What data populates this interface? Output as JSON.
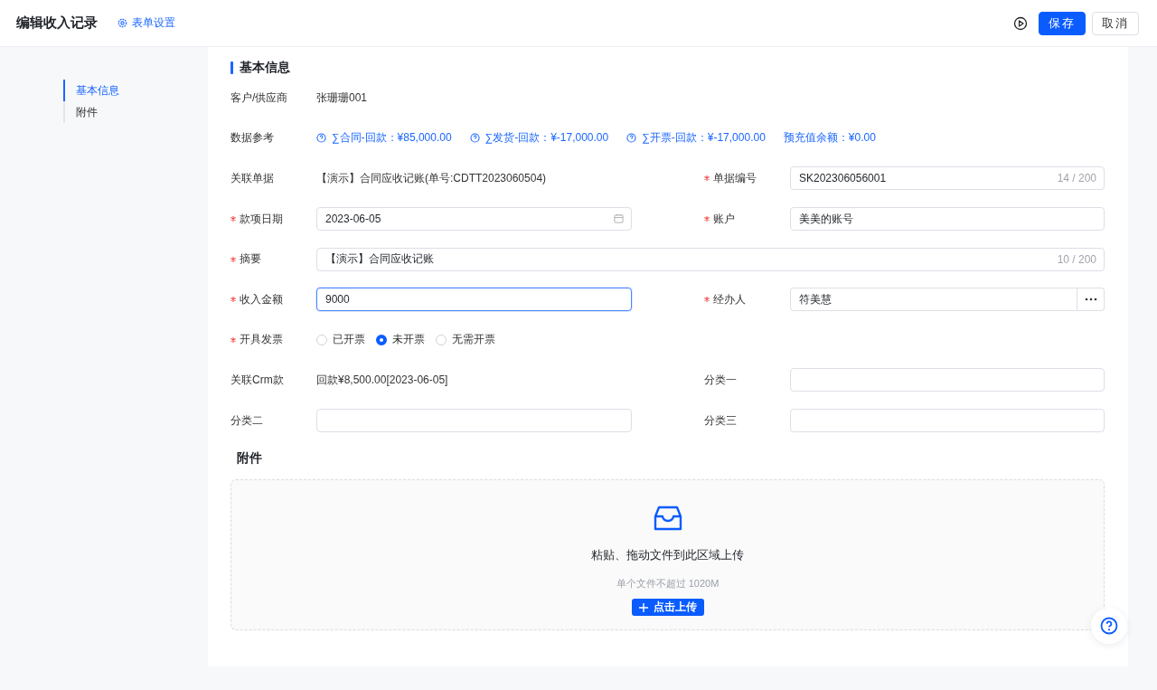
{
  "header": {
    "title": "编辑收入记录",
    "settings_link": "表单设置",
    "save_button": "保存",
    "cancel_button": "取消"
  },
  "nav": [
    {
      "label": "基本信息",
      "selected": true
    },
    {
      "label": "附件",
      "selected": false
    }
  ],
  "basic_info": {
    "title": "基本信息",
    "rows": [
      [
        {
          "label": "客户/供应商",
          "kind": "text",
          "required": false,
          "value": "张珊珊001"
        },
        null
      ],
      [
        {
          "label": "数据参考",
          "kind": "refs",
          "required": false,
          "refs": [
            {
              "text": "∑合同-回款：¥85,000.00",
              "has_icon": true
            },
            {
              "text": "∑发货-回款：¥-17,000.00",
              "has_icon": true
            },
            {
              "text": "∑开票-回款：¥-17,000.00",
              "has_icon": true
            },
            {
              "text": "预充值余额：¥0.00",
              "has_icon": false
            }
          ]
        }
      ],
      [
        {
          "label": "关联单据",
          "kind": "text",
          "required": false,
          "value": "【演示】合同应收记账(单号:CDTT2023060504)"
        },
        {
          "label": "单据编号",
          "kind": "input",
          "required": true,
          "value": "SK202306056001",
          "count": "14 / 200",
          "focused": false
        }
      ],
      [
        {
          "label": "款项日期",
          "kind": "date",
          "required": true,
          "value": "2023-06-05",
          "focused": false
        },
        {
          "label": "账户",
          "kind": "input",
          "required": true,
          "value": "美美的账号",
          "focused": false
        }
      ],
      [
        {
          "label": "摘要",
          "kind": "input",
          "required": true,
          "value": "【演示】合同应收记账",
          "count": "10 / 200",
          "focused": false
        }
      ],
      [
        {
          "label": "收入金额",
          "kind": "input",
          "required": true,
          "value": "9000",
          "focused": true
        },
        {
          "label": "经办人",
          "kind": "picker",
          "required": true,
          "value": "符美慧",
          "focused": false
        }
      ],
      [
        {
          "label": "开具发票",
          "kind": "radio",
          "required": true,
          "options": [
            {
              "label": "已开票",
              "selected": false
            },
            {
              "label": "未开票",
              "selected": true
            },
            {
              "label": "无需开票",
              "selected": false
            }
          ]
        },
        null
      ],
      [
        {
          "label": "关联Crm款",
          "kind": "text",
          "required": false,
          "value": "回款¥8,500.00[2023-06-05]"
        },
        {
          "label": "分类一",
          "kind": "input",
          "required": false,
          "focused": false
        }
      ],
      [
        {
          "label": "分类二",
          "kind": "input",
          "required": false,
          "focused": false
        },
        {
          "label": "分类三",
          "kind": "input",
          "required": false,
          "focused": false
        }
      ]
    ]
  },
  "attachments": {
    "title": "附件",
    "upload": {
      "prompt": "粘贴、拖动文件到此区域上传",
      "hint": "单个文件不超过 1020M",
      "button": "点击上传"
    }
  }
}
